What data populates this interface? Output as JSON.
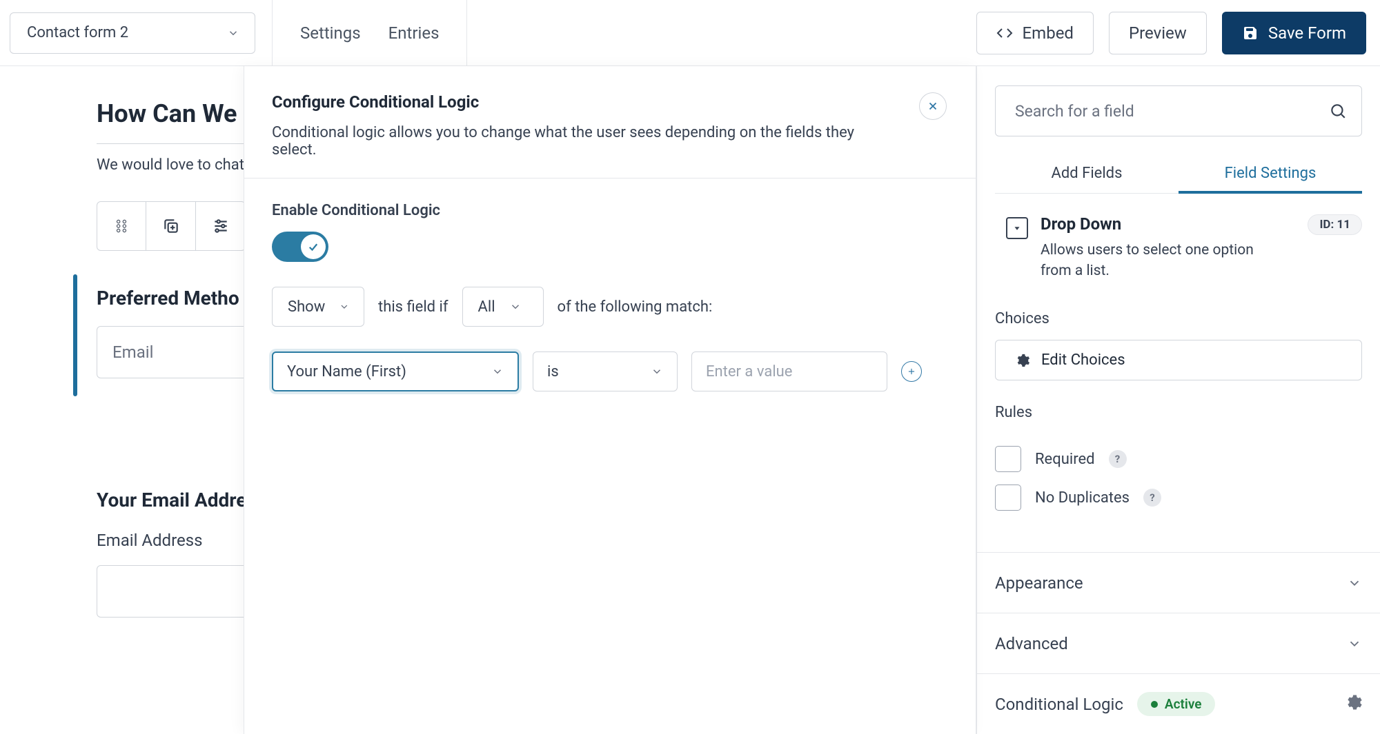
{
  "topbar": {
    "form_name": "Contact form 2",
    "tabs": {
      "settings": "Settings",
      "entries": "Entries"
    },
    "embed": "Embed",
    "preview": "Preview",
    "save": "Save Form"
  },
  "canvas": {
    "title": "How Can We",
    "intro": "We would love to chat",
    "preferred_label": "Preferred Metho",
    "preferred_value": "Email",
    "email_heading": "Your Email Addre",
    "email_sublabel": "Email Address"
  },
  "modal": {
    "title": "Configure Conditional Logic",
    "description": "Conditional logic allows you to change what the user sees depending on the fields they select.",
    "enable_label": "Enable Conditional Logic",
    "action": "Show",
    "mid1": "this field if",
    "scope": "All",
    "mid2": "of the following match:",
    "rule_field": "Your Name (First)",
    "rule_op": "is",
    "rule_value_placeholder": "Enter a value"
  },
  "sidebar": {
    "search_placeholder": "Search for a field",
    "tabs": {
      "add": "Add Fields",
      "settings": "Field Settings"
    },
    "field": {
      "name": "Drop Down",
      "desc": "Allows users to select one option from a list.",
      "id_chip": "ID: 11"
    },
    "choices_label": "Choices",
    "edit_choices": "Edit Choices",
    "rules_label": "Rules",
    "required": "Required",
    "no_duplicates": "No Duplicates",
    "help": "?",
    "appearance": "Appearance",
    "advanced": "Advanced",
    "conditional_logic": "Conditional Logic",
    "active": "Active"
  }
}
